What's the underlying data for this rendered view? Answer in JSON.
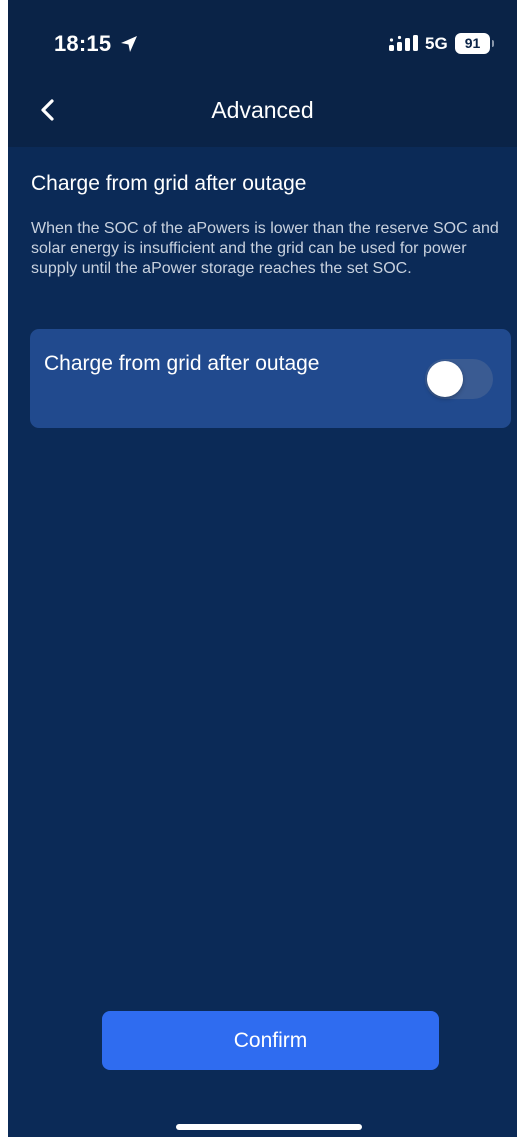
{
  "status_bar": {
    "time": "18:15",
    "network": "5G",
    "battery": "91",
    "location_icon": "location-arrow-icon",
    "signal_icon": "signal-bars-icon"
  },
  "nav": {
    "title": "Advanced",
    "back_icon": "chevron-left-icon"
  },
  "section": {
    "title": "Charge from grid after outage",
    "description": "When the SOC of the aPowers is lower than the reserve SOC and solar energy is insufficient and the grid can be used for power supply until the aPower storage reaches the set SOC."
  },
  "option": {
    "label": "Charge from grid after outage",
    "enabled": false
  },
  "actions": {
    "confirm_label": "Confirm"
  },
  "colors": {
    "background": "#0b2a57",
    "header": "#0a2347",
    "card": "#214a8e",
    "primary": "#2f6cf0"
  }
}
